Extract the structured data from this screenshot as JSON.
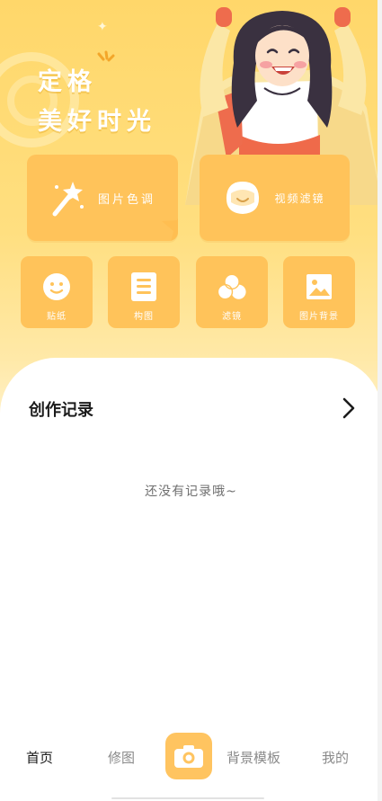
{
  "hero": {
    "headline_line1": "定格",
    "headline_line2": "美好时光"
  },
  "feature_cards": [
    {
      "label": "图片色调",
      "icon": "magic-wand-icon"
    },
    {
      "label": "视频滤镜",
      "icon": "face-mask-icon"
    }
  ],
  "tools": [
    {
      "label": "贴纸",
      "icon": "smiley-sticker-icon"
    },
    {
      "label": "构图",
      "icon": "document-layout-icon"
    },
    {
      "label": "滤镜",
      "icon": "filter-circles-icon"
    },
    {
      "label": "图片背景",
      "icon": "image-background-icon"
    }
  ],
  "records": {
    "title": "创作记录",
    "empty_text": "还没有记录哦~"
  },
  "tabbar": {
    "tabs": [
      {
        "label": "首页",
        "active": true
      },
      {
        "label": "修图",
        "active": false
      },
      {
        "label": "背景模板",
        "active": false
      },
      {
        "label": "我的",
        "active": false
      }
    ],
    "center_icon": "camera-icon"
  },
  "colors": {
    "accent": "#ffc35a",
    "hero_bg": "#ffd76a",
    "tab_underline": "#ffb732"
  }
}
